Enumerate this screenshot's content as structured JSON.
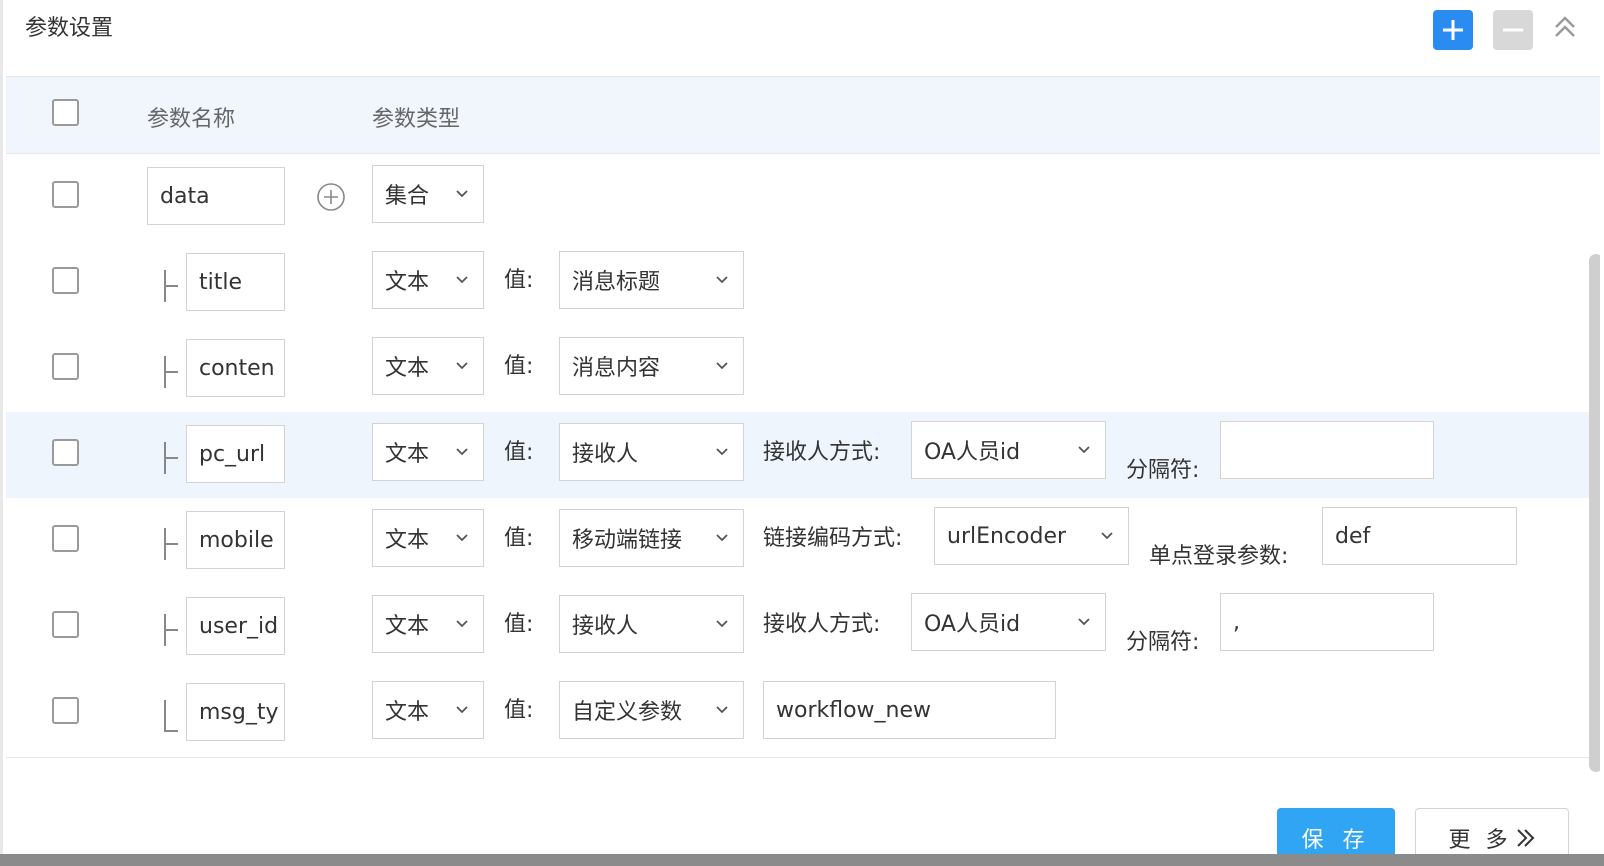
{
  "header": {
    "title": "参数设置"
  },
  "table_header": {
    "param_name": "参数名称",
    "param_type": "参数类型"
  },
  "rows": [
    {
      "name": "data",
      "type": "集合"
    },
    {
      "name": "title",
      "type": "文本",
      "value_label": "值:",
      "value": "消息标题"
    },
    {
      "name": "conten",
      "type": "文本",
      "value_label": "值:",
      "value": "消息内容"
    },
    {
      "name": "pc_url",
      "type": "文本",
      "value_label": "值:",
      "value": "接收人",
      "extra_label": "接收人方式:",
      "extra_value": "OA人员id",
      "sep_label": "分隔符:",
      "sep_value": ""
    },
    {
      "name": "mobile",
      "type": "文本",
      "value_label": "值:",
      "value": "移动端链接",
      "extra_label": "链接编码方式:",
      "extra_value": "urlEncoder",
      "sep_label": "单点登录参数:",
      "sep_value": "def"
    },
    {
      "name": "user_id",
      "type": "文本",
      "value_label": "值:",
      "value": "接收人",
      "extra_label": "接收人方式:",
      "extra_value": "OA人员id",
      "sep_label": "分隔符:",
      "sep_value": ","
    },
    {
      "name": "msg_ty",
      "type": "文本",
      "value_label": "值:",
      "value": "自定义参数",
      "custom_value": "workflow_new"
    }
  ],
  "footer": {
    "save_label": "保 存",
    "more_label": "更 多"
  },
  "colors": {
    "primary": "#2a8cf0",
    "save": "#2fa5f3",
    "header_bg": "#f0f6fc",
    "highlight_row": "#eef5fc"
  }
}
